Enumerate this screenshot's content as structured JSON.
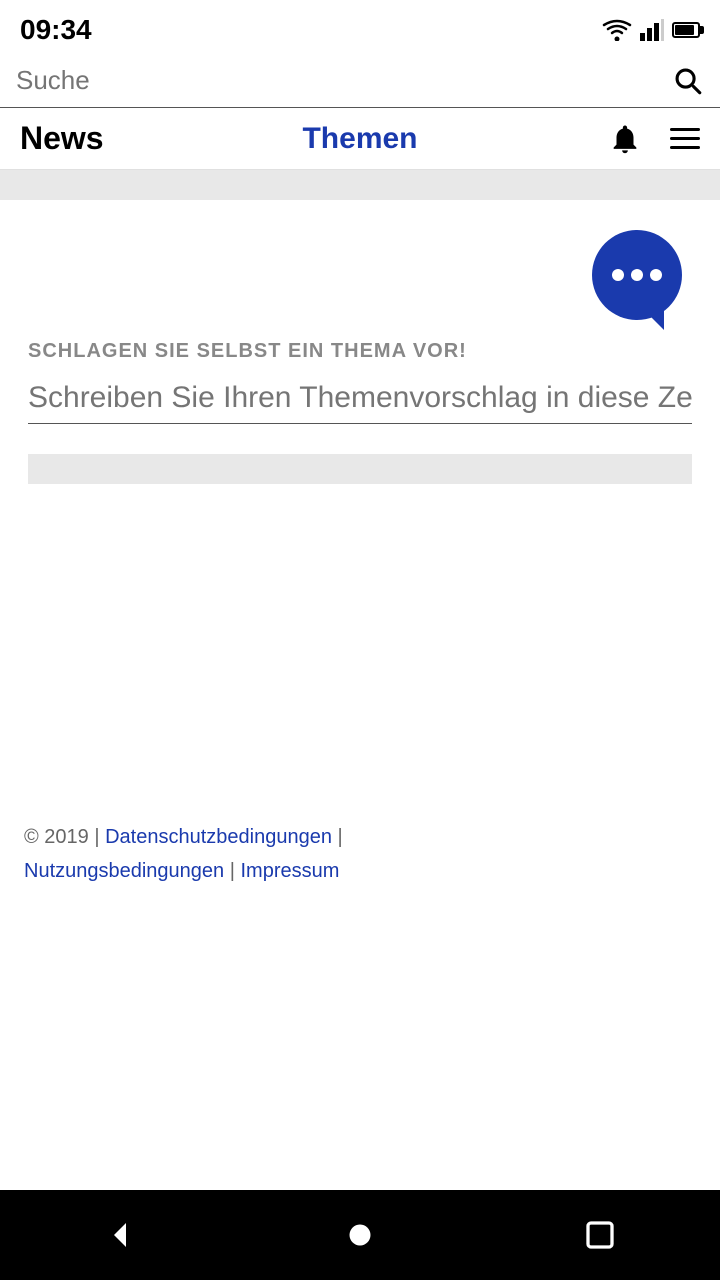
{
  "status": {
    "time": "09:34"
  },
  "search": {
    "placeholder": "Suche"
  },
  "nav": {
    "news_label": "News",
    "themen_label": "Themen"
  },
  "main": {
    "suggest_label": "SCHLAGEN SIE SELBST EIN THEMA VOR!",
    "suggest_input_placeholder": "Schreiben Sie Ihren Themenvorschlag in diese Zeile"
  },
  "footer": {
    "copyright": "© 2019 |",
    "datenschutz_label": "Datenschutzbedingungen",
    "separator1": "|",
    "nutzung_label": "Nutzungsbedingungen",
    "separator2": "|",
    "impressum_label": "Impressum"
  }
}
